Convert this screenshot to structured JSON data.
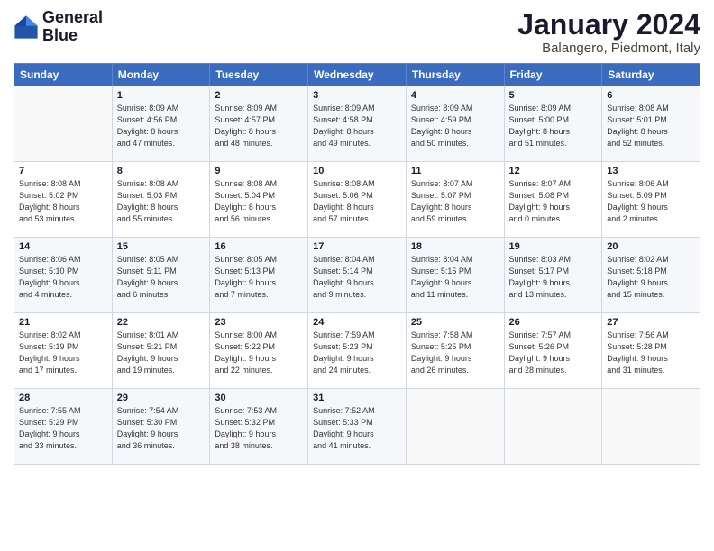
{
  "logo": {
    "line1": "General",
    "line2": "Blue"
  },
  "title": "January 2024",
  "location": "Balangero, Piedmont, Italy",
  "weekdays": [
    "Sunday",
    "Monday",
    "Tuesday",
    "Wednesday",
    "Thursday",
    "Friday",
    "Saturday"
  ],
  "weeks": [
    [
      {
        "num": "",
        "info": ""
      },
      {
        "num": "1",
        "info": "Sunrise: 8:09 AM\nSunset: 4:56 PM\nDaylight: 8 hours\nand 47 minutes."
      },
      {
        "num": "2",
        "info": "Sunrise: 8:09 AM\nSunset: 4:57 PM\nDaylight: 8 hours\nand 48 minutes."
      },
      {
        "num": "3",
        "info": "Sunrise: 8:09 AM\nSunset: 4:58 PM\nDaylight: 8 hours\nand 49 minutes."
      },
      {
        "num": "4",
        "info": "Sunrise: 8:09 AM\nSunset: 4:59 PM\nDaylight: 8 hours\nand 50 minutes."
      },
      {
        "num": "5",
        "info": "Sunrise: 8:09 AM\nSunset: 5:00 PM\nDaylight: 8 hours\nand 51 minutes."
      },
      {
        "num": "6",
        "info": "Sunrise: 8:08 AM\nSunset: 5:01 PM\nDaylight: 8 hours\nand 52 minutes."
      }
    ],
    [
      {
        "num": "7",
        "info": "Sunrise: 8:08 AM\nSunset: 5:02 PM\nDaylight: 8 hours\nand 53 minutes."
      },
      {
        "num": "8",
        "info": "Sunrise: 8:08 AM\nSunset: 5:03 PM\nDaylight: 8 hours\nand 55 minutes."
      },
      {
        "num": "9",
        "info": "Sunrise: 8:08 AM\nSunset: 5:04 PM\nDaylight: 8 hours\nand 56 minutes."
      },
      {
        "num": "10",
        "info": "Sunrise: 8:08 AM\nSunset: 5:06 PM\nDaylight: 8 hours\nand 57 minutes."
      },
      {
        "num": "11",
        "info": "Sunrise: 8:07 AM\nSunset: 5:07 PM\nDaylight: 8 hours\nand 59 minutes."
      },
      {
        "num": "12",
        "info": "Sunrise: 8:07 AM\nSunset: 5:08 PM\nDaylight: 9 hours\nand 0 minutes."
      },
      {
        "num": "13",
        "info": "Sunrise: 8:06 AM\nSunset: 5:09 PM\nDaylight: 9 hours\nand 2 minutes."
      }
    ],
    [
      {
        "num": "14",
        "info": "Sunrise: 8:06 AM\nSunset: 5:10 PM\nDaylight: 9 hours\nand 4 minutes."
      },
      {
        "num": "15",
        "info": "Sunrise: 8:05 AM\nSunset: 5:11 PM\nDaylight: 9 hours\nand 6 minutes."
      },
      {
        "num": "16",
        "info": "Sunrise: 8:05 AM\nSunset: 5:13 PM\nDaylight: 9 hours\nand 7 minutes."
      },
      {
        "num": "17",
        "info": "Sunrise: 8:04 AM\nSunset: 5:14 PM\nDaylight: 9 hours\nand 9 minutes."
      },
      {
        "num": "18",
        "info": "Sunrise: 8:04 AM\nSunset: 5:15 PM\nDaylight: 9 hours\nand 11 minutes."
      },
      {
        "num": "19",
        "info": "Sunrise: 8:03 AM\nSunset: 5:17 PM\nDaylight: 9 hours\nand 13 minutes."
      },
      {
        "num": "20",
        "info": "Sunrise: 8:02 AM\nSunset: 5:18 PM\nDaylight: 9 hours\nand 15 minutes."
      }
    ],
    [
      {
        "num": "21",
        "info": "Sunrise: 8:02 AM\nSunset: 5:19 PM\nDaylight: 9 hours\nand 17 minutes."
      },
      {
        "num": "22",
        "info": "Sunrise: 8:01 AM\nSunset: 5:21 PM\nDaylight: 9 hours\nand 19 minutes."
      },
      {
        "num": "23",
        "info": "Sunrise: 8:00 AM\nSunset: 5:22 PM\nDaylight: 9 hours\nand 22 minutes."
      },
      {
        "num": "24",
        "info": "Sunrise: 7:59 AM\nSunset: 5:23 PM\nDaylight: 9 hours\nand 24 minutes."
      },
      {
        "num": "25",
        "info": "Sunrise: 7:58 AM\nSunset: 5:25 PM\nDaylight: 9 hours\nand 26 minutes."
      },
      {
        "num": "26",
        "info": "Sunrise: 7:57 AM\nSunset: 5:26 PM\nDaylight: 9 hours\nand 28 minutes."
      },
      {
        "num": "27",
        "info": "Sunrise: 7:56 AM\nSunset: 5:28 PM\nDaylight: 9 hours\nand 31 minutes."
      }
    ],
    [
      {
        "num": "28",
        "info": "Sunrise: 7:55 AM\nSunset: 5:29 PM\nDaylight: 9 hours\nand 33 minutes."
      },
      {
        "num": "29",
        "info": "Sunrise: 7:54 AM\nSunset: 5:30 PM\nDaylight: 9 hours\nand 36 minutes."
      },
      {
        "num": "30",
        "info": "Sunrise: 7:53 AM\nSunset: 5:32 PM\nDaylight: 9 hours\nand 38 minutes."
      },
      {
        "num": "31",
        "info": "Sunrise: 7:52 AM\nSunset: 5:33 PM\nDaylight: 9 hours\nand 41 minutes."
      },
      {
        "num": "",
        "info": ""
      },
      {
        "num": "",
        "info": ""
      },
      {
        "num": "",
        "info": ""
      }
    ]
  ]
}
